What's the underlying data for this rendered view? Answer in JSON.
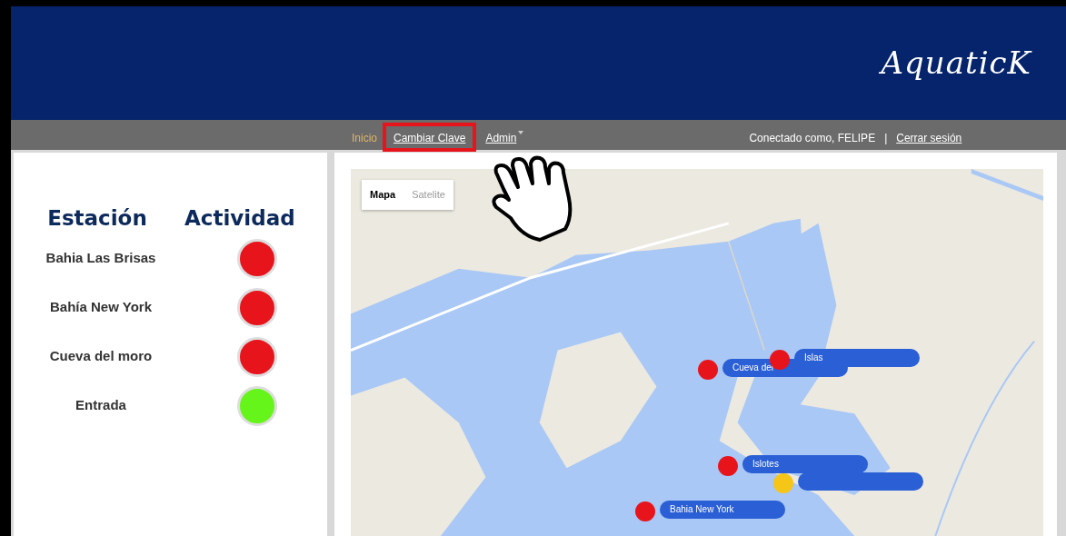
{
  "header": {
    "logo": "AquaticK"
  },
  "nav": {
    "items": [
      {
        "label": "Inicio",
        "selected": true,
        "highlighted": false,
        "dropdown": false
      },
      {
        "label": "Cambiar Clave",
        "selected": false,
        "highlighted": true,
        "dropdown": false
      },
      {
        "label": "Admin",
        "selected": false,
        "highlighted": false,
        "dropdown": true
      }
    ],
    "user_text": "Conectado como, FELIPE",
    "separator": "|",
    "logout": "Cerrar sesión"
  },
  "stations": {
    "columns": [
      "Estación",
      "Actividad"
    ],
    "rows": [
      {
        "name": "Bahia Las Brisas",
        "color": "#e8141c"
      },
      {
        "name": "Bahía New York",
        "color": "#e8141c"
      },
      {
        "name": "Cueva del moro",
        "color": "#e8141c"
      },
      {
        "name": "Entrada",
        "color": "#66f51a"
      }
    ]
  },
  "map": {
    "kind": "picture",
    "type_buttons": [
      {
        "label": "Mapa",
        "selected": true
      },
      {
        "label": "Satelite",
        "selected": false
      }
    ],
    "markers": [
      {
        "label": "Cueva del",
        "color": "#e8141c"
      },
      {
        "label": "Islas",
        "color": "#e8141c"
      },
      {
        "label": "Islotes",
        "color": "#e8141c"
      },
      {
        "color": "#f5c518"
      },
      {
        "label": "Bahia New York",
        "color": "#e8141c"
      }
    ]
  }
}
